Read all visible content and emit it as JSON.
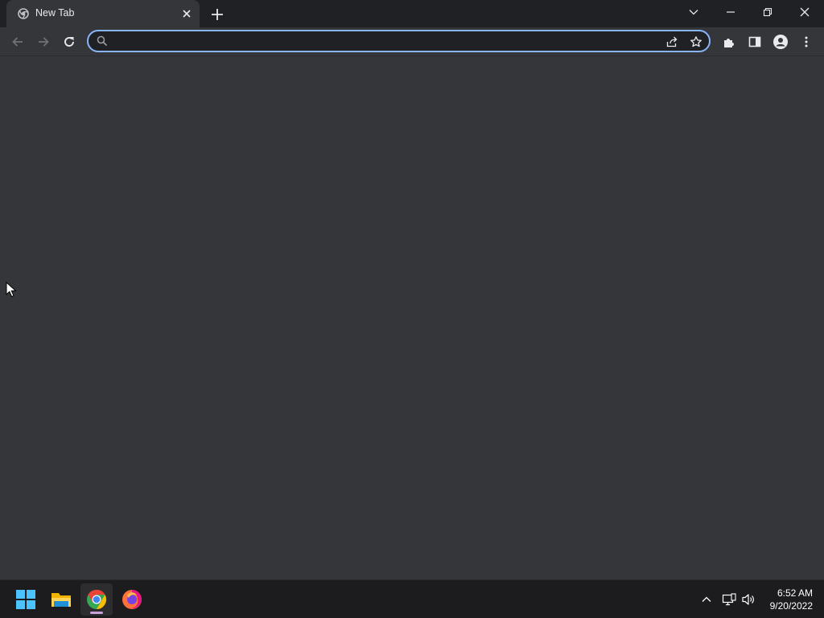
{
  "browser": {
    "tab": {
      "title": "New Tab"
    },
    "omnibox": {
      "value": "",
      "placeholder": ""
    }
  },
  "taskbar": {
    "apps": [
      "start-menu",
      "file-explorer",
      "google-chrome",
      "firefox"
    ],
    "active_app": "google-chrome",
    "clock": {
      "time": "6:52 AM",
      "date": "9/20/2022"
    }
  },
  "colors": {
    "accent": "#8ab4f8",
    "page_background": "#35363a",
    "titlebar": "#202124",
    "taskbar": "#1c1c1e"
  }
}
